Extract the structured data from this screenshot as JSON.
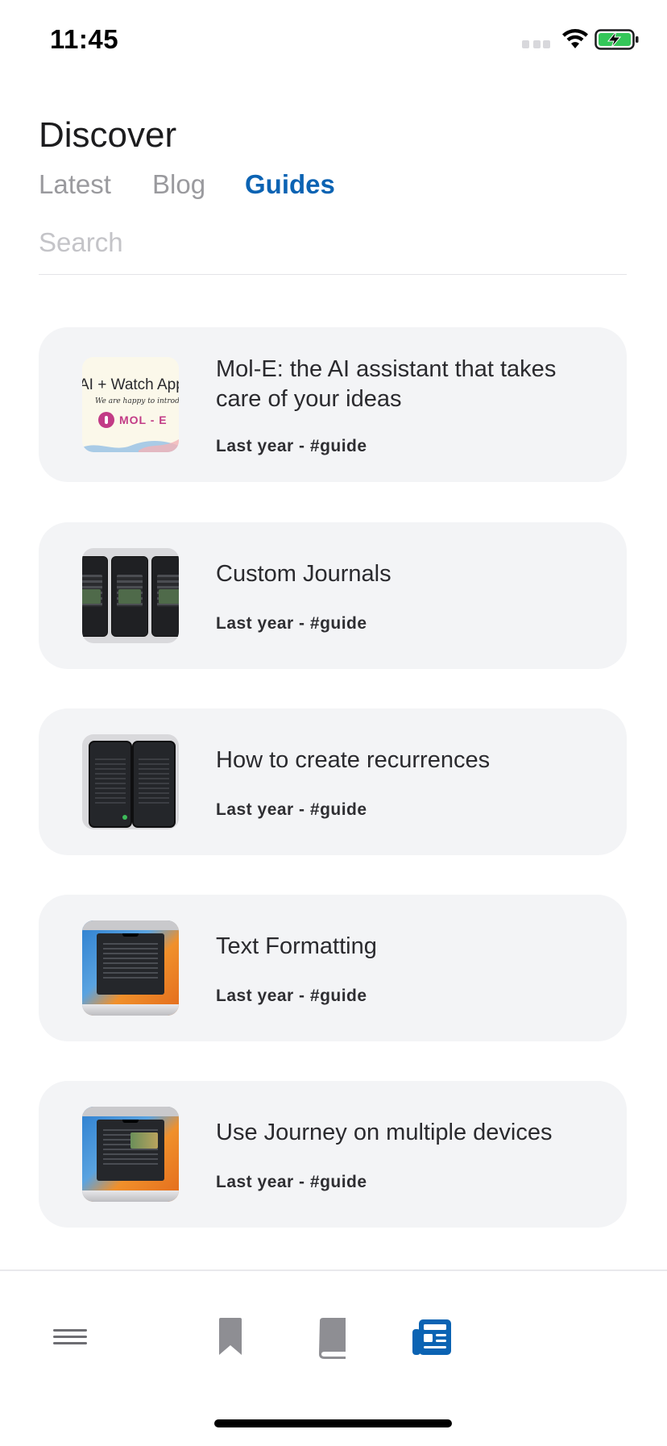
{
  "status_bar": {
    "time": "11:45",
    "icons": [
      "signal-icon",
      "wifi-icon",
      "battery-charging-icon"
    ]
  },
  "header": {
    "title": "Discover",
    "tabs": [
      {
        "label": "Latest",
        "active": false
      },
      {
        "label": "Blog",
        "active": false
      },
      {
        "label": "Guides",
        "active": true
      }
    ]
  },
  "search": {
    "placeholder": "Search",
    "value": ""
  },
  "guides": [
    {
      "title": "Mol-E: the AI assistant that takes care of your ideas",
      "meta": "Last year - #guide",
      "thumb": "mole-thumbnail",
      "thumb_text": {
        "line1": "AI + Watch App",
        "line2": "We are happy to introduce",
        "brand": "MOL - E"
      }
    },
    {
      "title": "Custom Journals",
      "meta": "Last year - #guide",
      "thumb": "phones-thumbnail"
    },
    {
      "title": "How to create recurrences",
      "meta": "Last year - #guide",
      "thumb": "recurrence-thumbnail"
    },
    {
      "title": "Text Formatting",
      "meta": "Last year - #guide",
      "thumb": "mac-thumbnail"
    },
    {
      "title": "Use Journey on multiple devices",
      "meta": "Last year - #guide",
      "thumb": "mac-multi-thumbnail"
    }
  ],
  "tab_bar": {
    "items": [
      {
        "icon": "menu-icon",
        "active": false
      },
      {
        "icon": "bookmark-icon",
        "active": false
      },
      {
        "icon": "book-icon",
        "active": false
      },
      {
        "icon": "newspaper-icon",
        "active": true
      }
    ]
  },
  "colors": {
    "accent": "#0b63b3",
    "inactive_tab": "#9a9a9e",
    "card_bg": "#f3f4f6",
    "icon_gray": "#8e8e93"
  }
}
